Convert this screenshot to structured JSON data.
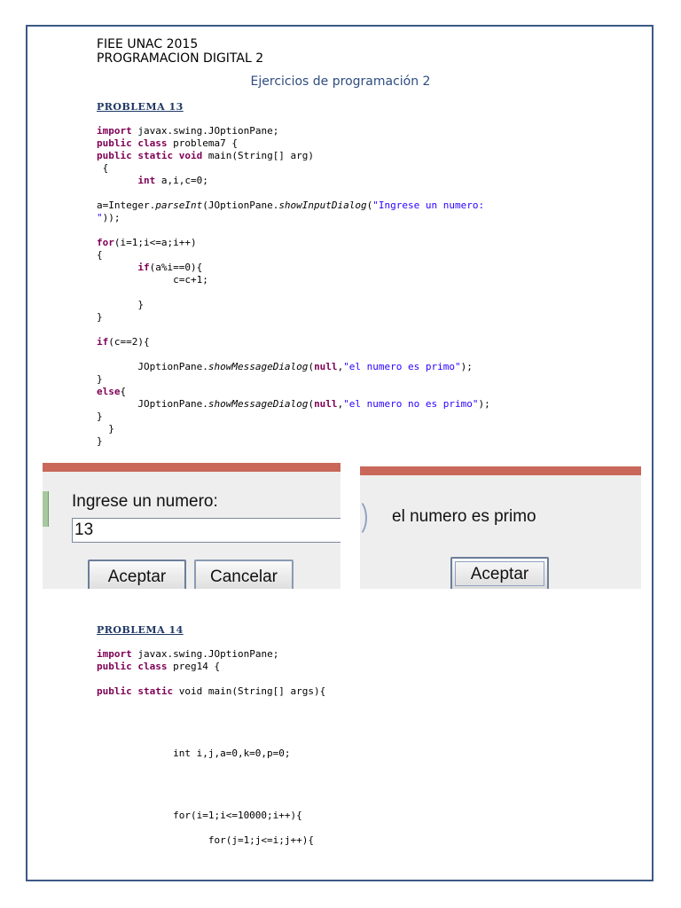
{
  "header": {
    "line1": "FIEE UNAC   2015",
    "line2": "PROGRAMACION DIGITAL 2",
    "subtitle": "Ejercicios de programación 2"
  },
  "problem13": {
    "title": "PROBLEMA 13"
  },
  "problem14": {
    "title": "PROBLEMA 14"
  },
  "input_dialog": {
    "prompt": "Ingrese un numero:",
    "value": "13",
    "accept_label": "Aceptar",
    "cancel_label": "Cancelar"
  },
  "message_dialog": {
    "message": "el numero es primo",
    "accept_label": "Aceptar"
  }
}
